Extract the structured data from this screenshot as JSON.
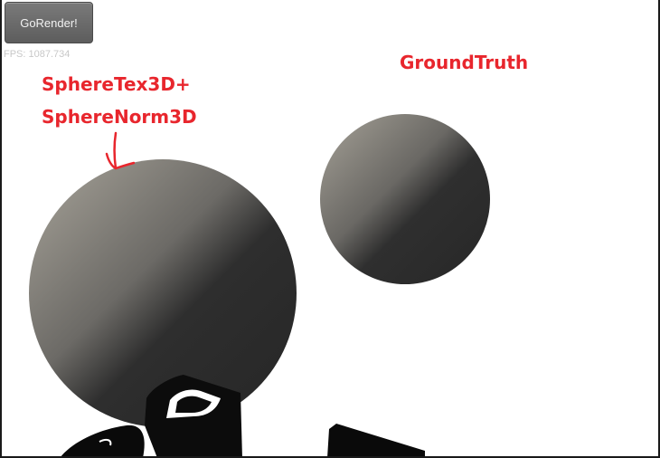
{
  "toolbar": {
    "render_button_label": "GoRender!"
  },
  "stats": {
    "fps_text": "FPS: 1087.734"
  },
  "annotations": {
    "left_label_line1": "SphereTex3D+",
    "left_label_line2": "SphereNorm3D",
    "right_label": "GroundTruth",
    "annotation_color": "#e8262d"
  },
  "scene": {
    "background_color": "#ffffff",
    "sphere_light_color": "#a8a49a",
    "sphere_dark_color": "#2a2a2a",
    "shadow_object_color": "#0a0a0a"
  }
}
